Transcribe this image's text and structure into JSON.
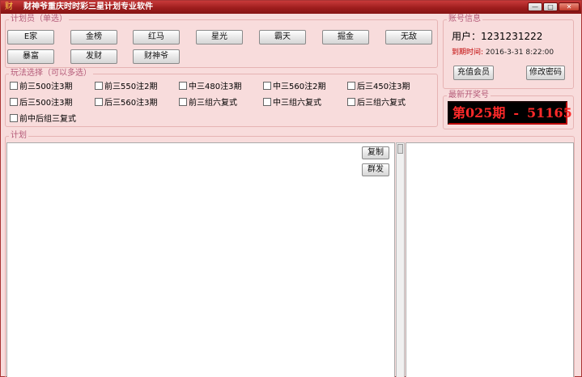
{
  "window": {
    "title": "财神爷重庆时时彩三星计划专业软件",
    "icon": "money-god-icon",
    "controls": [
      "minimize",
      "maximize",
      "close"
    ]
  },
  "planners": {
    "legend": "计划员（单选）",
    "buttons": [
      "E家",
      "金榜",
      "红马",
      "星光",
      "霸天",
      "掘金",
      "无敌",
      "暴富",
      "发财",
      "财神爷"
    ]
  },
  "play": {
    "legend": "玩法选择（可以多选）",
    "options": [
      "前三500注3期",
      "前三550注2期",
      "中三480注3期",
      "中三560注2期",
      "后三450注3期",
      "后三500注3期",
      "后三560注3期",
      "前三组六复式",
      "中三组六复式",
      "后三组六复式",
      "前中后组三复式"
    ]
  },
  "account": {
    "legend": "账号信息",
    "user_label": "用户：",
    "user_value": "1231231222",
    "expire_label": "到期时间:",
    "expire_value": "2016-3-31  8:22:00",
    "recharge_label": "充值会员",
    "change_pw_label": "修改密码"
  },
  "latest": {
    "legend": "最新开奖号",
    "period": "第025期",
    "separator": "-",
    "number": "51165"
  },
  "plan": {
    "legend": "计划",
    "copy_label": "复制",
    "publish_label": "群发"
  },
  "colors": {
    "title_bar": "#9e1d1d",
    "background": "#f8dcdc",
    "legend_text": "#b45a78",
    "display_bg": "#000000",
    "display_text": "#ff2a2a",
    "expire_label": "#c00000"
  }
}
